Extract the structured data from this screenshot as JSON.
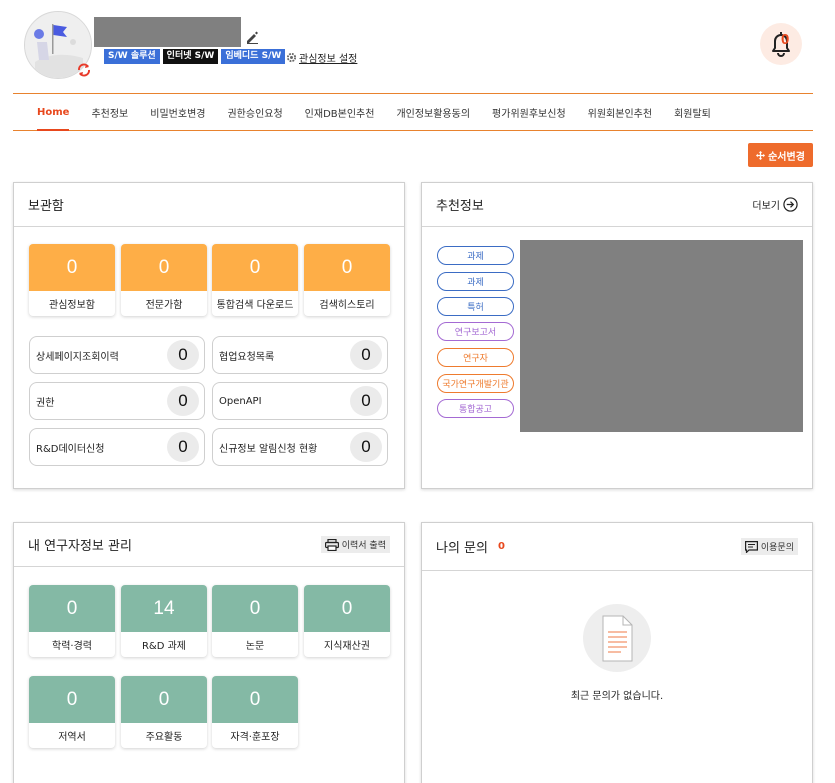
{
  "profile": {
    "tags": [
      {
        "label": "S/W 솔루션",
        "color": "#3a6fd8"
      },
      {
        "label": "인터넷 S/W",
        "color": "#111111"
      },
      {
        "label": "임베디드 S/W",
        "color": "#3a6fd8"
      }
    ],
    "interest_link": "관심정보 설정",
    "notification_count": "0"
  },
  "nav": {
    "items": [
      "Home",
      "추천정보",
      "비밀번호변경",
      "권한승인요청",
      "인재DB본인추천",
      "개인정보활용동의",
      "평가위원후보신청",
      "위원회본인추천",
      "회원탈퇴"
    ],
    "active_index": 0
  },
  "order_button": "순서변경",
  "storage": {
    "title": "보관함",
    "tiles": [
      {
        "value": "0",
        "label": "관심정보함"
      },
      {
        "value": "0",
        "label": "전문가함"
      },
      {
        "value": "0",
        "label": "통합검색 다운로드"
      },
      {
        "value": "0",
        "label": "검색히스토리"
      }
    ],
    "rows": [
      {
        "label": "상세페이지조회이력",
        "value": "0"
      },
      {
        "label": "협업요청목록",
        "value": "0"
      },
      {
        "label": "권한",
        "value": "0"
      },
      {
        "label": "OpenAPI",
        "value": "0"
      },
      {
        "label": "R&D데이터신청",
        "value": "0"
      },
      {
        "label": "신규정보 알림신청 현황",
        "value": "0"
      }
    ]
  },
  "recommend": {
    "title": "추천정보",
    "more": "더보기",
    "pills": [
      {
        "label": "과제",
        "color": "#3b6cc4"
      },
      {
        "label": "과제",
        "color": "#3b6cc4"
      },
      {
        "label": "특허",
        "color": "#3b6cc4"
      },
      {
        "label": "연구보고서",
        "color": "#a46ad3"
      },
      {
        "label": "연구자",
        "color": "#ee7b2e"
      },
      {
        "label": "국가연구개발기관",
        "color": "#ee7b2e"
      },
      {
        "label": "통합공고",
        "color": "#a46ad3"
      }
    ]
  },
  "researcher": {
    "title": "내 연구자정보 관리",
    "print_button": "이력서 출력",
    "tiles": [
      {
        "value": "0",
        "label": "학력·경력"
      },
      {
        "value": "14",
        "label": "R&D 과제"
      },
      {
        "value": "0",
        "label": "논문"
      },
      {
        "value": "0",
        "label": "지식재산권"
      },
      {
        "value": "0",
        "label": "저역서"
      },
      {
        "value": "0",
        "label": "주요활동"
      },
      {
        "value": "0",
        "label": "자격·훈포장"
      }
    ]
  },
  "inquiry": {
    "title": "나의 문의",
    "count": "0",
    "button": "이용문의",
    "empty_text": "최근 문의가 없습니다."
  }
}
